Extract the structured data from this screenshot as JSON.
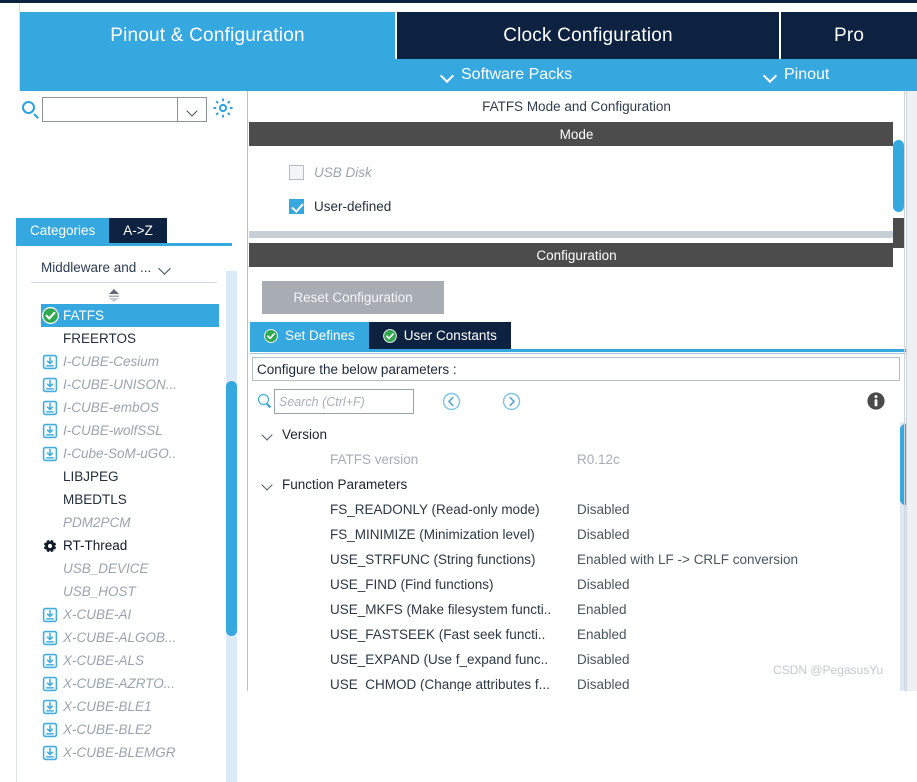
{
  "window": {
    "watermark": "CSDN @PegasusYu"
  },
  "main_tabs": [
    {
      "label": "Pinout & Configuration",
      "active": true
    },
    {
      "label": "Clock Configuration",
      "active": false
    },
    {
      "label": "Pro",
      "active": false
    }
  ],
  "sub_toolbar": {
    "items": [
      {
        "label": "Software Packs",
        "icon": "chevron-down-icon"
      },
      {
        "label": "Pinout",
        "icon": "chevron-down-icon"
      }
    ]
  },
  "sidebar": {
    "search": {
      "value": "",
      "placeholder": ""
    },
    "gear_icon": "gear-icon",
    "category_tabs": [
      {
        "label": "Categories",
        "active": true
      },
      {
        "label": "A->Z",
        "active": false
      }
    ],
    "group": {
      "label": "Middleware and ...",
      "chevron": "chevron-down-icon"
    },
    "components": [
      {
        "label": "FATFS",
        "state": "selected",
        "icon": "green-check-icon"
      },
      {
        "label": "FREERTOS",
        "state": "plain",
        "icon": "none"
      },
      {
        "label": "I-CUBE-Cesium",
        "state": "dim",
        "icon": "download-icon"
      },
      {
        "label": "I-CUBE-UNISON...",
        "state": "dim",
        "icon": "download-icon"
      },
      {
        "label": "I-CUBE-embOS",
        "state": "dim",
        "icon": "download-icon"
      },
      {
        "label": "I-CUBE-wolfSSL",
        "state": "dim",
        "icon": "download-icon"
      },
      {
        "label": "I-Cube-SoM-uGO..",
        "state": "dim",
        "icon": "download-icon"
      },
      {
        "label": "LIBJPEG",
        "state": "plain",
        "icon": "none"
      },
      {
        "label": "MBEDTLS",
        "state": "plain",
        "icon": "none"
      },
      {
        "label": "PDM2PCM",
        "state": "dim",
        "icon": "none"
      },
      {
        "label": "RT-Thread",
        "state": "bold-dark",
        "icon": "gear-dark-icon"
      },
      {
        "label": "USB_DEVICE",
        "state": "dim",
        "icon": "none"
      },
      {
        "label": "USB_HOST",
        "state": "dim",
        "icon": "none"
      },
      {
        "label": "X-CUBE-AI",
        "state": "dim",
        "icon": "download-icon"
      },
      {
        "label": "X-CUBE-ALGOB...",
        "state": "dim",
        "icon": "download-icon"
      },
      {
        "label": "X-CUBE-ALS",
        "state": "dim",
        "icon": "download-icon"
      },
      {
        "label": "X-CUBE-AZRTO...",
        "state": "dim",
        "icon": "download-icon"
      },
      {
        "label": "X-CUBE-BLE1",
        "state": "dim",
        "icon": "download-icon"
      },
      {
        "label": "X-CUBE-BLE2",
        "state": "dim",
        "icon": "download-icon"
      },
      {
        "label": "X-CUBE-BLEMGR",
        "state": "dim",
        "icon": "download-icon"
      }
    ]
  },
  "main": {
    "panel_title": "FATFS Mode and Configuration",
    "mode_section_label": "Mode",
    "mode_options": [
      {
        "label": "USB Disk",
        "checked": false,
        "enabled": false
      },
      {
        "label": "User-defined",
        "checked": true,
        "enabled": true
      }
    ],
    "configuration_section_label": "Configuration",
    "reset_button": "Reset Configuration",
    "config_tabs": [
      {
        "label": "Set Defines",
        "active": true,
        "icon": "green-check-icon"
      },
      {
        "label": "User Constants",
        "active": false,
        "icon": "green-check-icon"
      }
    ],
    "configure_hint": "Configure the below parameters :",
    "param_search": {
      "value": "",
      "placeholder": "Search (Ctrl+F)"
    },
    "nav_prev_icon": "circle-left-arrow-icon",
    "nav_next_icon": "circle-right-arrow-icon",
    "info_icon": "info-icon",
    "tree": [
      {
        "type": "group",
        "label": "Version",
        "expanded": true
      },
      {
        "type": "param",
        "name": "FATFS version",
        "value": "R0.12c",
        "dim": true
      },
      {
        "type": "group",
        "label": "Function Parameters",
        "expanded": true
      },
      {
        "type": "param",
        "name": "FS_READONLY (Read-only mode)",
        "value": "Disabled",
        "dim": false
      },
      {
        "type": "param",
        "name": "FS_MINIMIZE (Minimization level)",
        "value": "Disabled",
        "dim": false
      },
      {
        "type": "param",
        "name": "USE_STRFUNC (String functions)",
        "value": "Enabled with LF -> CRLF conversion",
        "dim": false
      },
      {
        "type": "param",
        "name": "USE_FIND (Find functions)",
        "value": "Disabled",
        "dim": false
      },
      {
        "type": "param",
        "name": "USE_MKFS (Make filesystem functi..",
        "value": "Enabled",
        "dim": false
      },
      {
        "type": "param",
        "name": "USE_FASTSEEK (Fast seek functi..",
        "value": "Enabled",
        "dim": false
      },
      {
        "type": "param",
        "name": "USE_EXPAND (Use f_expand func..",
        "value": "Disabled",
        "dim": false
      },
      {
        "type": "param",
        "name": "USE_CHMOD (Change attributes f...",
        "value": "Disabled",
        "dim": false
      }
    ]
  },
  "colors": {
    "accent_blue": "#35a8e0",
    "dark_navy": "#0d2240",
    "section_gray": "#4c4c4c",
    "disabled_gray": "#9aa4ae"
  }
}
